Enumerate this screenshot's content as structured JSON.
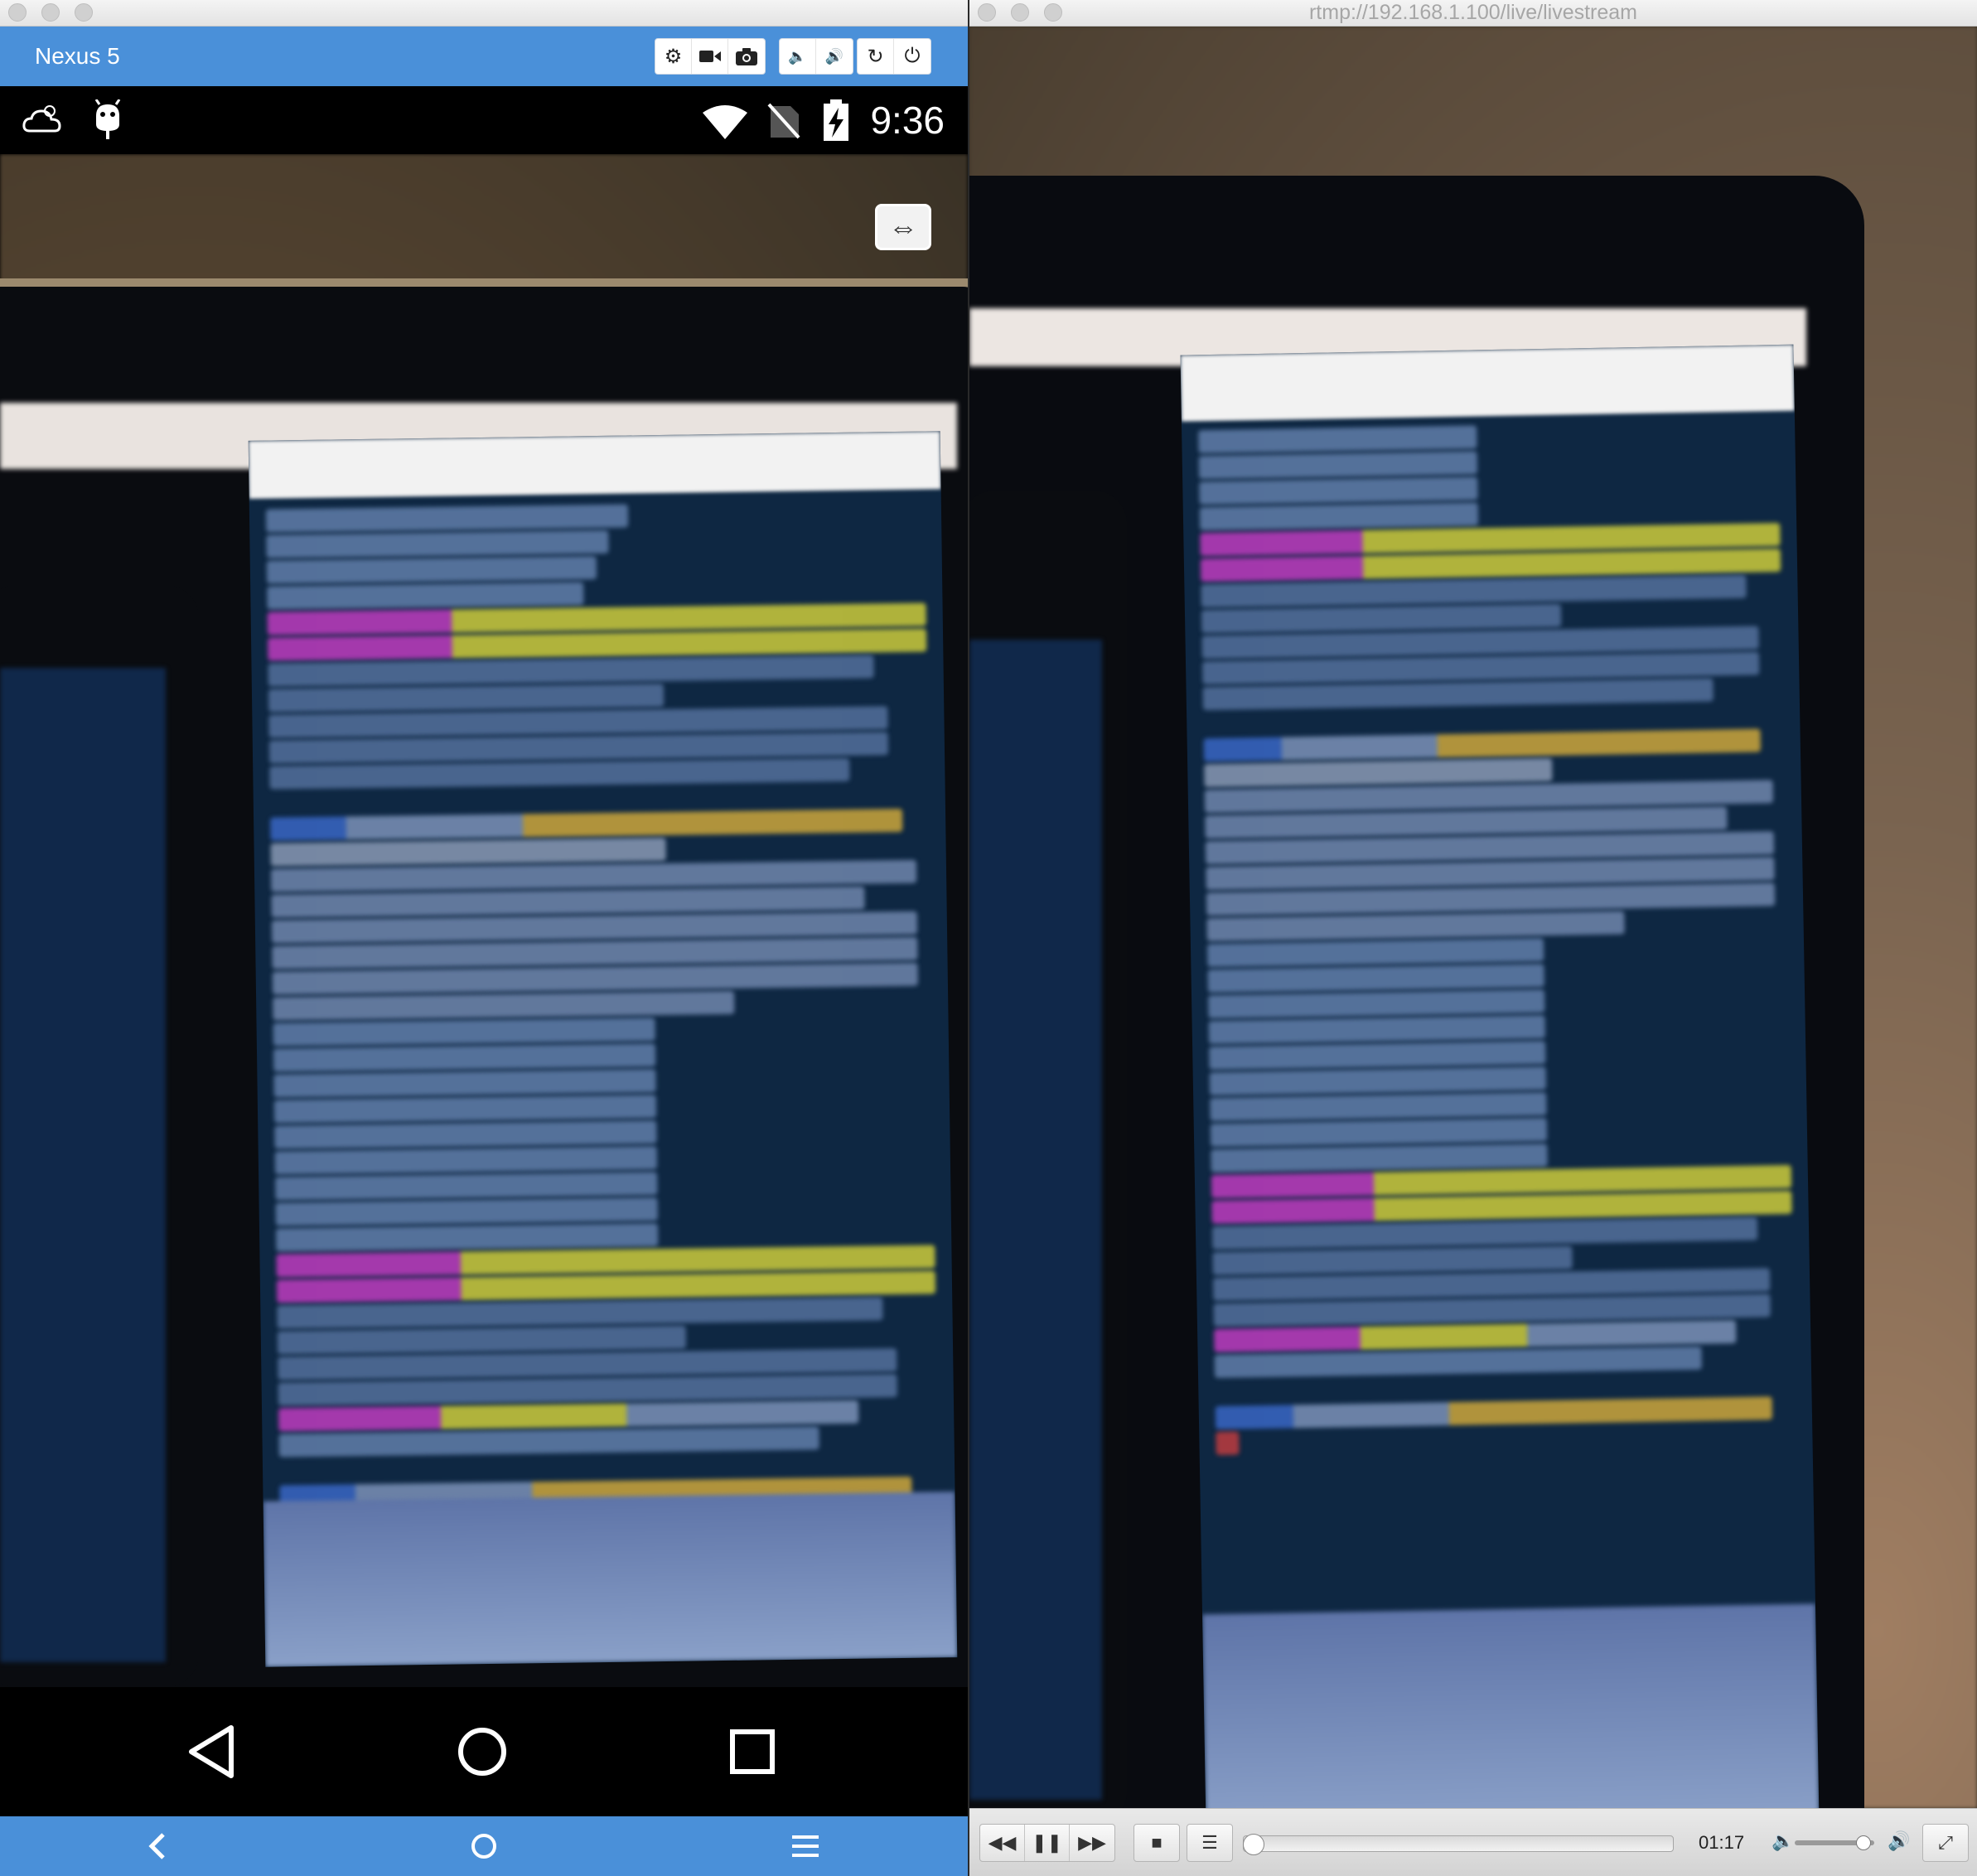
{
  "emulator": {
    "device_name": "Nexus 5",
    "toolbar_icons": [
      "gear-icon",
      "video-camera-icon",
      "camera-icon",
      "volume-down-icon",
      "volume-up-icon",
      "rotate-icon",
      "power-icon"
    ],
    "status_bar": {
      "time": "9:36",
      "left_icons": [
        "weather-icon",
        "android-debug-icon"
      ],
      "right_icons": [
        "wifi-icon",
        "no-sim-icon",
        "battery-charging-icon"
      ]
    },
    "camera_switch_icon": "switch-camera-icon",
    "nav_icons": [
      "back-icon",
      "home-icon",
      "recents-icon"
    ],
    "bottom_icons": [
      "chevron-left-icon",
      "circle-icon",
      "menu-icon"
    ]
  },
  "player": {
    "window_title": "rtmp://192.168.1.100/live/livestream",
    "time": "01:17",
    "progress": 0.0,
    "volume": 0.95
  },
  "colors": {
    "emulator_accent": "#4a90d9",
    "terminal_bg": "#0e2742",
    "terminal_yellow": "#e6e23a",
    "terminal_magenta": "#d63fd0"
  }
}
